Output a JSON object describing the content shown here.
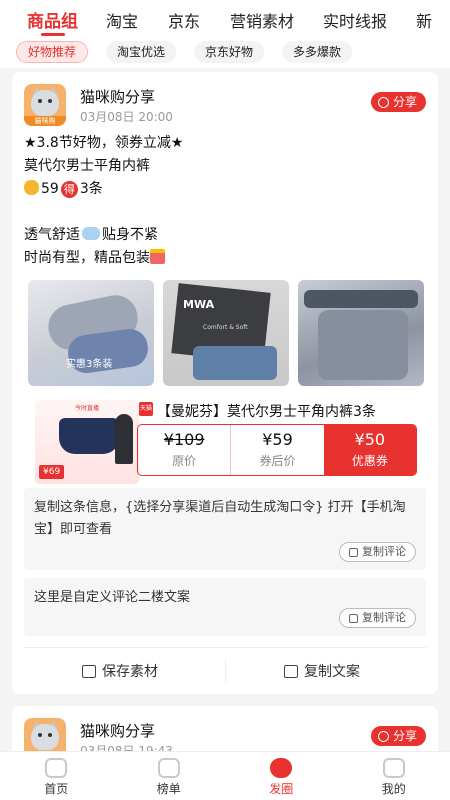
{
  "top_tabs": [
    "商品组",
    "淘宝",
    "京东",
    "营销素材",
    "实时线报",
    "新"
  ],
  "sub_tabs": [
    "好物推荐",
    "淘宝优选",
    "京东好物",
    "多多爆款"
  ],
  "post": {
    "user": "猫咪购分享",
    "time": "03月08日 20:00",
    "avatar_label": "猫咪购",
    "share_label": "分享",
    "line1": "★3.8节好物，领券立减★",
    "line2": "莫代尔男士平角内裤",
    "line3_price": "59",
    "line3_de": "得",
    "line3_count": "3条",
    "line4a": "透气舒适",
    "line4b": "贴身不紧",
    "line5": "时尚有型，精品包装",
    "photo1_caption": "实惠3条装",
    "photo2_logo": "MWA",
    "photo2_sub": "Comfort & Soft",
    "product": {
      "thumb_title": "今时直播",
      "thumb_price": "¥69",
      "tmall_badge": "天猫",
      "title": "【曼妮芬】莫代尔男士平角内裤3条",
      "orig_price": "¥109",
      "orig_label": "原价",
      "after_price": "¥59",
      "after_label": "券后价",
      "coupon": "¥50",
      "coupon_label": "优惠券"
    },
    "comment1": "复制这条信息，{选择分享渠道后自动生成淘口令} 打开【手机淘宝】即可查看",
    "comment2": "这里是自定义评论二楼文案",
    "copy_comment_label": "复制评论",
    "save_label": "保存素材",
    "copy_text_label": "复制文案"
  },
  "post2": {
    "user": "猫咪购分享",
    "time": "03月08日 19:43",
    "share_label": "分享"
  },
  "tabbar": [
    "首页",
    "榜单",
    "发圈",
    "我的"
  ],
  "colors": {
    "accent": "#e8322f"
  }
}
